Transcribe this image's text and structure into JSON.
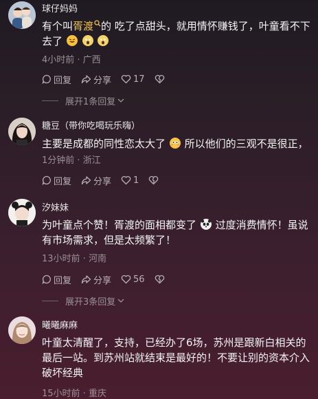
{
  "comments": [
    {
      "username": "球仔妈妈",
      "text_before": "有个叫",
      "keyword": "胥渡",
      "text_after": "的 吃了点甜头，就用情怀赚钱了，叶童看不下去了",
      "time_location": "4小时前 · 广西",
      "reply_label": "回复",
      "share_label": "分享",
      "like_count": "17",
      "expand_label": "展开1条回复"
    },
    {
      "username": "糖豆（带你吃喝玩乐嗨）",
      "text_before": "主要是成都的同性恋太大了",
      "text_after": "所以他们的三观不是很正，",
      "time_location": "1分钟前 · 浙江",
      "reply_label": "回复",
      "share_label": "分享",
      "like_count": "1"
    },
    {
      "username": "汐妹妹",
      "text_before": "为叶童点个赞！胥渡的面相都变了",
      "text_after": "过度消费情怀！虽说有市场需求，但是太频繁了！",
      "time_location": "13小时前 · 河南",
      "reply_label": "回复",
      "share_label": "分享",
      "like_count": "56",
      "expand_label": "展开3条回复"
    },
    {
      "username": "曦曦麻麻",
      "text": "叶童太清醒了，支持，已经办了6场，苏州是跟新白相关的最后一站。到苏州站就结束是最好的！不要让别的资本介入破坏经典",
      "time_location": "15小时前 · 重庆"
    }
  ],
  "icons": {
    "search": "search-icon",
    "reply": "comment-bubble-icon",
    "share": "share-arrow-icon",
    "like": "heart-icon",
    "dislike": "broken-heart-icon",
    "expand": "chevron-down-icon"
  },
  "colors": {
    "keyword": "#f1c24a",
    "meta": "#9a9097"
  }
}
